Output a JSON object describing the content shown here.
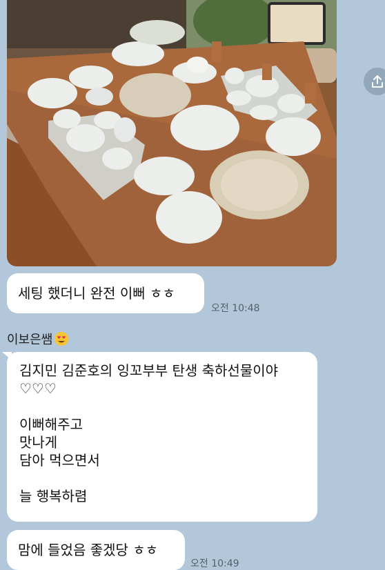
{
  "photo": {
    "alt_icon": "table-setting-photo"
  },
  "share": {
    "icon": "share-icon"
  },
  "messages": [
    {
      "text": "세팅 했더니 완전 이뻐 ㅎㅎ",
      "time": "오전 10:48"
    },
    {
      "sender": "이보은쌤",
      "sender_emoji": "heart-eyes-emoji",
      "lines": [
        "김지민 김준호의 잉꼬부부 탄생 축하선물이야",
        "♡♡♡",
        "",
        "이뻐해주고",
        "맛나게",
        "담아 먹으면서",
        "",
        "늘 행복하렴"
      ]
    },
    {
      "text": "맘에 들었음 좋겠당 ㅎㅎ",
      "time": "오전 10:49"
    }
  ],
  "colors": {
    "background": "#b2c7d9",
    "bubble": "#ffffff",
    "time": "#555f6a"
  }
}
